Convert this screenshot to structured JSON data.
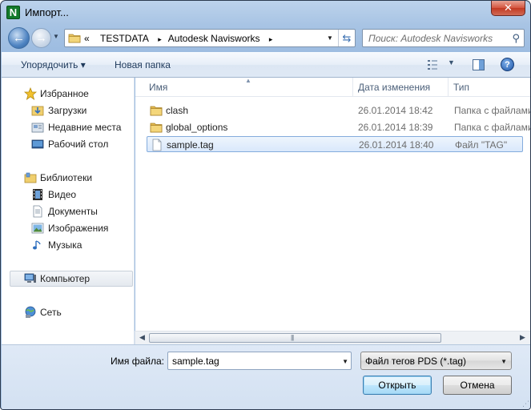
{
  "window": {
    "title": "Импорт...",
    "app_icon_letter": "N",
    "close_glyph": "✕"
  },
  "address": {
    "overflow": "«",
    "crumbs": [
      "TESTDATA",
      "Autodesk Navisworks"
    ],
    "separator": "▸",
    "search_placeholder": "Поиск: Autodesk Navisworks"
  },
  "toolbar": {
    "organize_label": "Упорядочить ▾",
    "new_folder_label": "Новая папка",
    "help_glyph": "?"
  },
  "navpane": {
    "favorites": {
      "label": "Избранное",
      "items": [
        {
          "label": "Загрузки"
        },
        {
          "label": "Недавние места"
        },
        {
          "label": "Рабочий стол"
        }
      ]
    },
    "libraries": {
      "label": "Библиотеки",
      "items": [
        {
          "label": "Видео"
        },
        {
          "label": "Документы"
        },
        {
          "label": "Изображения"
        },
        {
          "label": "Музыка"
        }
      ]
    },
    "computer": {
      "label": "Компьютер"
    },
    "network": {
      "label": "Сеть"
    }
  },
  "filelist": {
    "columns": {
      "name": "Имя",
      "date": "Дата изменения",
      "type": "Тип"
    },
    "rows": [
      {
        "name": "clash",
        "date": "26.01.2014 18:42",
        "type": "Папка с файлами",
        "icon": "folder-icon"
      },
      {
        "name": "global_options",
        "date": "26.01.2014 18:39",
        "type": "Папка с файлами",
        "icon": "folder-icon"
      },
      {
        "name": "sample.tag",
        "date": "26.01.2014 18:40",
        "type": "Файл \"TAG\"",
        "icon": "file-icon",
        "selected": true
      }
    ]
  },
  "bottom": {
    "file_name_label": "Имя файла:",
    "file_name_value": "sample.tag",
    "file_type_value": "Файл тегов PDS (*.tag)",
    "open_label": "Открыть",
    "cancel_label": "Отмена"
  }
}
